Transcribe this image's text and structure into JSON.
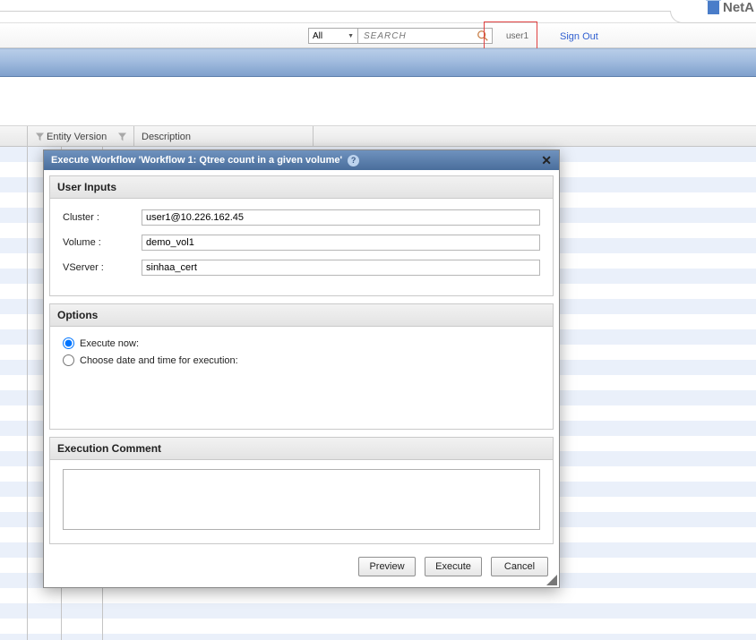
{
  "brand": {
    "name": "NetA"
  },
  "topbar": {
    "search_scope": "All",
    "search_placeholder": "SEARCH",
    "user": "user1",
    "sign_out": "Sign Out"
  },
  "table_headers": {
    "entity_version": "Entity Version",
    "description": "Description"
  },
  "dialog": {
    "title": "Execute Workflow 'Workflow 1: Qtree count in a given volume'",
    "help_glyph": "?",
    "close_glyph": "✕",
    "sections": {
      "user_inputs": {
        "title": "User Inputs",
        "fields": {
          "cluster_label": "Cluster :",
          "cluster_value": "user1@10.226.162.45",
          "volume_label": "Volume :",
          "volume_value": "demo_vol1",
          "vserver_label": "VServer :",
          "vserver_value": "sinhaa_cert"
        }
      },
      "options": {
        "title": "Options",
        "execute_now": "Execute now:",
        "choose_date": "Choose date and time for execution:"
      },
      "execution_comment": {
        "title": "Execution Comment",
        "value": ""
      }
    },
    "buttons": {
      "preview": "Preview",
      "execute": "Execute",
      "cancel": "Cancel"
    }
  }
}
